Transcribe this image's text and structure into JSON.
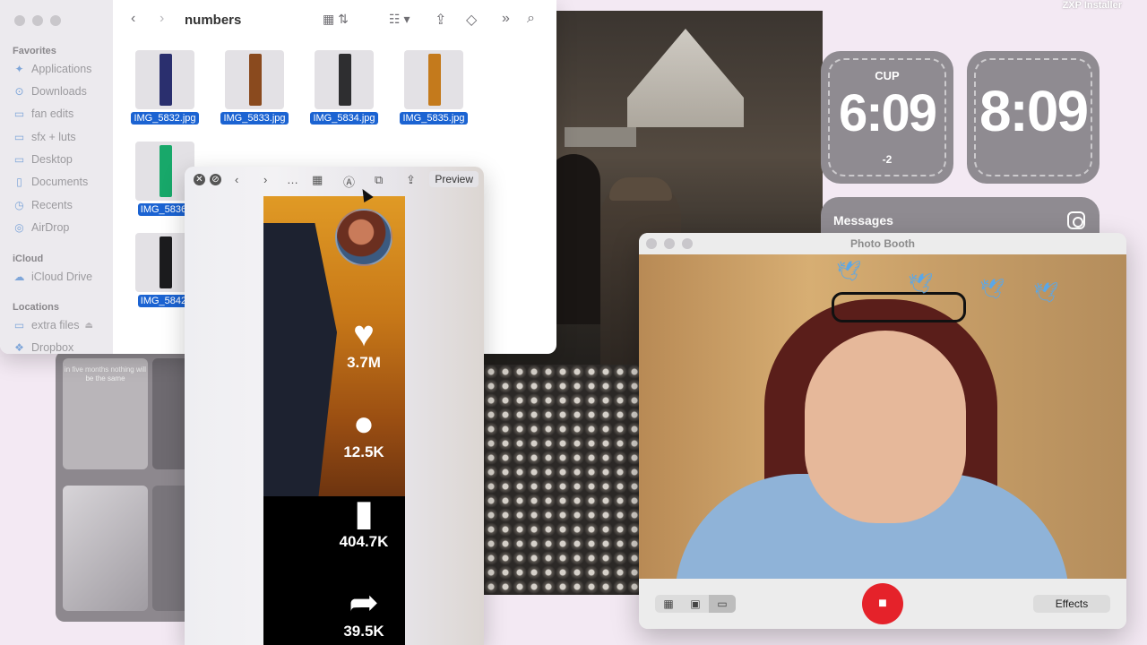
{
  "desktop": {
    "top_right_text": "ZXP Installer",
    "pin_text": "in five months nothing will be the same"
  },
  "widgets": {
    "clock1": {
      "city": "CUP",
      "time": "6:09",
      "offset": "-2"
    },
    "clock2": {
      "time": "8:09"
    },
    "messages": {
      "title": "Messages"
    }
  },
  "finder": {
    "title": "numbers",
    "sidebar": {
      "favorites_heading": "Favorites",
      "favorites": [
        {
          "label": "Applications",
          "icon": "applications-icon"
        },
        {
          "label": "Downloads",
          "icon": "downloads-icon"
        },
        {
          "label": "fan edits",
          "icon": "folder-icon"
        },
        {
          "label": "sfx + luts",
          "icon": "folder-icon"
        },
        {
          "label": "Desktop",
          "icon": "desktop-icon"
        },
        {
          "label": "Documents",
          "icon": "documents-icon"
        },
        {
          "label": "Recents",
          "icon": "recents-icon"
        },
        {
          "label": "AirDrop",
          "icon": "airdrop-icon"
        }
      ],
      "icloud_heading": "iCloud",
      "icloud": [
        {
          "label": "iCloud Drive",
          "icon": "cloud-icon"
        }
      ],
      "locations_heading": "Locations",
      "locations": [
        {
          "label": "extra files",
          "icon": "drive-icon"
        },
        {
          "label": "Dropbox",
          "icon": "dropbox-icon"
        }
      ]
    },
    "files": [
      {
        "name": "IMG_5832.jpg",
        "color": "#2a2f6e"
      },
      {
        "name": "IMG_5833.jpg",
        "color": "#8a4a1e"
      },
      {
        "name": "IMG_5834.jpg",
        "color": "#2e2e30"
      },
      {
        "name": "IMG_5835.jpg",
        "color": "#c47a1c"
      },
      {
        "name": "IMG_5836.",
        "color": "#18a86a"
      },
      {
        "name": "IMG_5842.",
        "color": "#1c1c1e"
      }
    ]
  },
  "preview": {
    "open_button": "Preview",
    "stats": [
      {
        "icon": "heart-icon",
        "glyph": "♥",
        "value": "3.7M"
      },
      {
        "icon": "comment-icon",
        "glyph": "●",
        "value": "12.5K"
      },
      {
        "icon": "bookmark-icon",
        "glyph": "▮",
        "value": "404.7K"
      },
      {
        "icon": "share-arrow-icon",
        "glyph": "➦",
        "value": "39.5K"
      }
    ]
  },
  "photo_booth": {
    "title": "Photo Booth",
    "effects_label": "Effects",
    "record_color": "#e5222a"
  }
}
